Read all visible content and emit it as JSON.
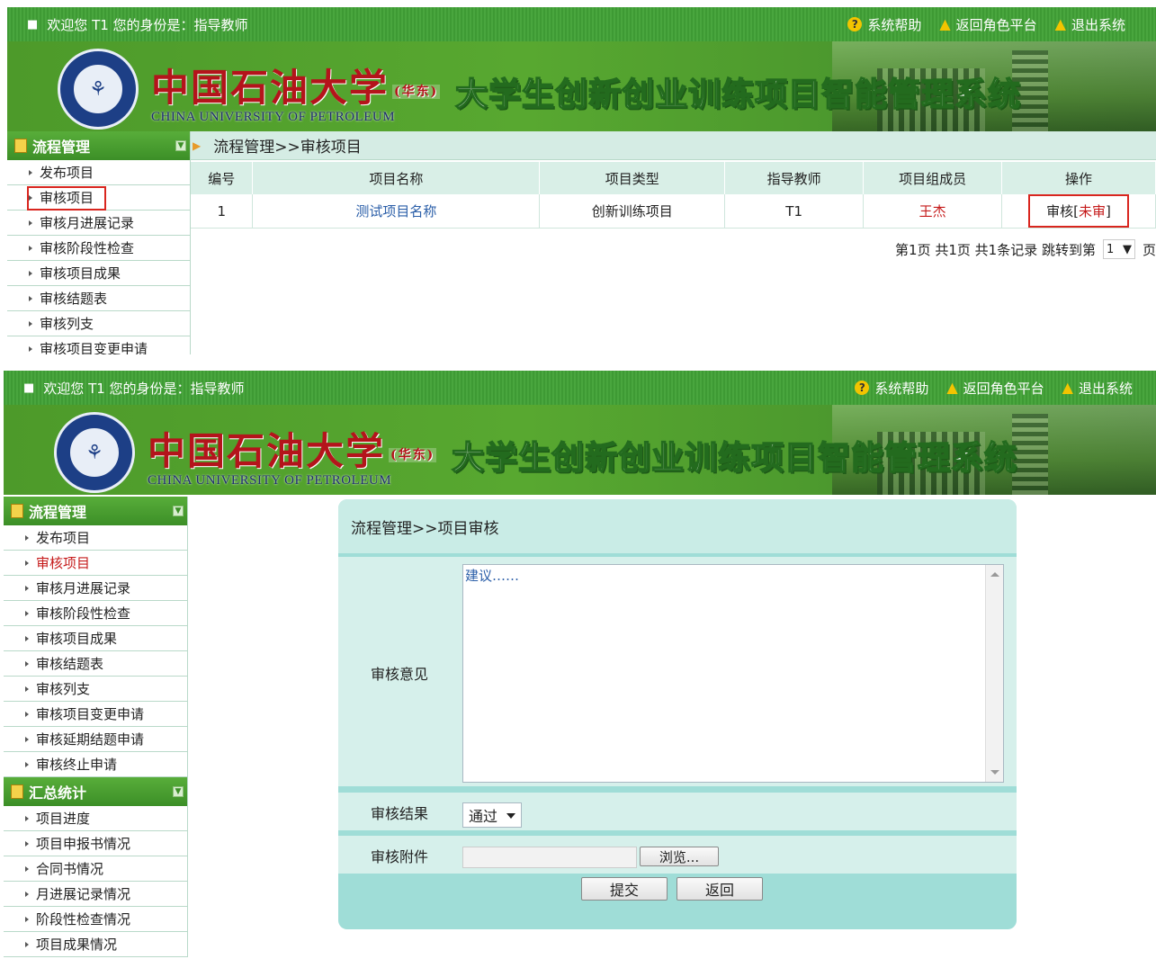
{
  "header": {
    "welcome": "欢迎您 T1 您的身份是：指导教师",
    "links": [
      "系统帮助",
      "返回角色平台",
      "退出系统"
    ],
    "university_cn": "中国石油大学",
    "university_sub": "(华东)",
    "university_en": "CHINA UNIVERSITY OF PETROLEUM",
    "system_title": "大学生创新创业训练项目智能管理系统"
  },
  "sidebar": {
    "group1_title": "流程管理",
    "group1_items": [
      "发布项目",
      "审核项目",
      "审核月进展记录",
      "审核阶段性检查",
      "审核项目成果",
      "审核结题表",
      "审核列支",
      "审核项目变更申请",
      "审核延期结题申请",
      "审核终止申请"
    ],
    "group2_title": "汇总统计",
    "group2_items": [
      "项目进度",
      "项目申报书情况",
      "合同书情况",
      "月进展记录情况",
      "阶段性检查情况",
      "项目成果情况"
    ]
  },
  "screen1": {
    "breadcrumb": "流程管理>>审核项目",
    "table": {
      "headers": [
        "编号",
        "项目名称",
        "项目类型",
        "指导教师",
        "项目组成员",
        "操作"
      ],
      "row": {
        "id": "1",
        "name": "测试项目名称",
        "type": "创新训练项目",
        "teacher": "T1",
        "member": "王杰",
        "op_prefix": "审核[",
        "op_status": "未审",
        "op_suffix": "]"
      }
    },
    "pager": {
      "text": "第1页 共1页 共1条记录 跳转到第",
      "page_value": "1",
      "suffix": "页"
    }
  },
  "screen2": {
    "breadcrumb": "流程管理>>项目审核",
    "opinion_label": "审核意见",
    "opinion_value": "建议……",
    "result_label": "审核结果",
    "result_value": "通过",
    "attachment_label": "审核附件",
    "browse_label": "浏览...",
    "submit_label": "提交",
    "back_label": "返回"
  },
  "colors": {
    "topbar_green": "#49a63e",
    "highlight_red": "#d9261f",
    "panel_teal": "#9fddd7",
    "link_blue": "#2a5ea8"
  }
}
